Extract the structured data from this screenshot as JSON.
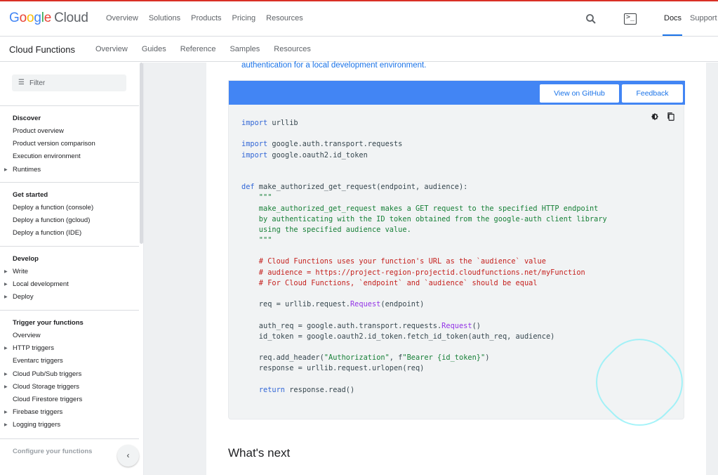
{
  "header": {
    "logo_google": [
      "G",
      "o",
      "o",
      "g",
      "l",
      "e"
    ],
    "logo_cloud": "Cloud",
    "nav": [
      "Overview",
      "Solutions",
      "Products",
      "Pricing",
      "Resources"
    ],
    "docs": "Docs",
    "support": "Support",
    "terminal_glyph": ">_"
  },
  "subheader": {
    "product": "Cloud Functions",
    "nav": [
      "Overview",
      "Guides",
      "Reference",
      "Samples",
      "Resources"
    ]
  },
  "sidebar": {
    "filter_placeholder": "Filter",
    "sections": [
      {
        "title": "Discover",
        "items": [
          {
            "label": "Product overview",
            "expandable": false
          },
          {
            "label": "Product version comparison",
            "expandable": false
          },
          {
            "label": "Execution environment",
            "expandable": false
          },
          {
            "label": "Runtimes",
            "expandable": true
          }
        ]
      },
      {
        "title": "Get started",
        "items": [
          {
            "label": "Deploy a function (console)",
            "expandable": false
          },
          {
            "label": "Deploy a function (gcloud)",
            "expandable": false
          },
          {
            "label": "Deploy a function (IDE)",
            "expandable": false
          }
        ]
      },
      {
        "title": "Develop",
        "items": [
          {
            "label": "Write",
            "expandable": true
          },
          {
            "label": "Local development",
            "expandable": true
          },
          {
            "label": "Deploy",
            "expandable": true
          }
        ]
      },
      {
        "title": "Trigger your functions",
        "items": [
          {
            "label": "Overview",
            "expandable": false
          },
          {
            "label": "HTTP triggers",
            "expandable": true
          },
          {
            "label": "Eventarc triggers",
            "expandable": false
          },
          {
            "label": "Cloud Pub/Sub triggers",
            "expandable": true
          },
          {
            "label": "Cloud Storage triggers",
            "expandable": true
          },
          {
            "label": "Cloud Firestore triggers",
            "expandable": false
          },
          {
            "label": "Firebase triggers",
            "expandable": true
          },
          {
            "label": "Logging triggers",
            "expandable": true
          }
        ]
      },
      {
        "title": "Configure your functions",
        "items": []
      }
    ],
    "collapse_glyph": "‹"
  },
  "content": {
    "intro_link": "authentication for a local development environment.",
    "view_on_github": "View on GitHub",
    "feedback": "Feedback",
    "whats_next": "What's next",
    "code_lines": [
      [
        [
          "kw",
          "import"
        ],
        [
          "t",
          " urllib"
        ]
      ],
      [],
      [
        [
          "kw",
          "import"
        ],
        [
          "t",
          " google.auth.transport.requests"
        ]
      ],
      [
        [
          "kw",
          "import"
        ],
        [
          "t",
          " google.oauth2.id_token"
        ]
      ],
      [],
      [],
      [
        [
          "kw",
          "def"
        ],
        [
          "t",
          " make_authorized_get_request(endpoint, audience):"
        ]
      ],
      [
        [
          "str",
          "    \"\"\""
        ]
      ],
      [
        [
          "str",
          "    make_authorized_get_request makes a GET request to the specified HTTP endpoint"
        ]
      ],
      [
        [
          "str",
          "    by authenticating with the ID token obtained from the google-auth client library"
        ]
      ],
      [
        [
          "str",
          "    using the specified audience value."
        ]
      ],
      [
        [
          "str",
          "    \"\"\""
        ]
      ],
      [],
      [
        [
          "cmt",
          "    # Cloud Functions uses your function's URL as the `audience` value"
        ]
      ],
      [
        [
          "cmt",
          "    # audience = https://project-region-projectid.cloudfunctions.net/myFunction"
        ]
      ],
      [
        [
          "cmt",
          "    # For Cloud Functions, `endpoint` and `audience` should be equal"
        ]
      ],
      [],
      [
        [
          "t",
          "    req = urllib.request."
        ],
        [
          "fn",
          "Request"
        ],
        [
          "t",
          "(endpoint)"
        ]
      ],
      [],
      [
        [
          "t",
          "    auth_req = google.auth.transport.requests."
        ],
        [
          "fn",
          "Request"
        ],
        [
          "t",
          "()"
        ]
      ],
      [
        [
          "t",
          "    id_token = google.oauth2.id_token.fetch_id_token(auth_req, audience)"
        ]
      ],
      [],
      [
        [
          "t",
          "    req.add_header("
        ],
        [
          "str",
          "\"Authorization\""
        ],
        [
          "t",
          ", f"
        ],
        [
          "str",
          "\"Bearer {id_token}\""
        ],
        [
          "t",
          ")"
        ]
      ],
      [
        [
          "t",
          "    response = urllib.request.urlopen(req)"
        ]
      ],
      [],
      [
        [
          "t",
          "    "
        ],
        [
          "kw",
          "return"
        ],
        [
          "t",
          " response.read()"
        ]
      ]
    ]
  }
}
